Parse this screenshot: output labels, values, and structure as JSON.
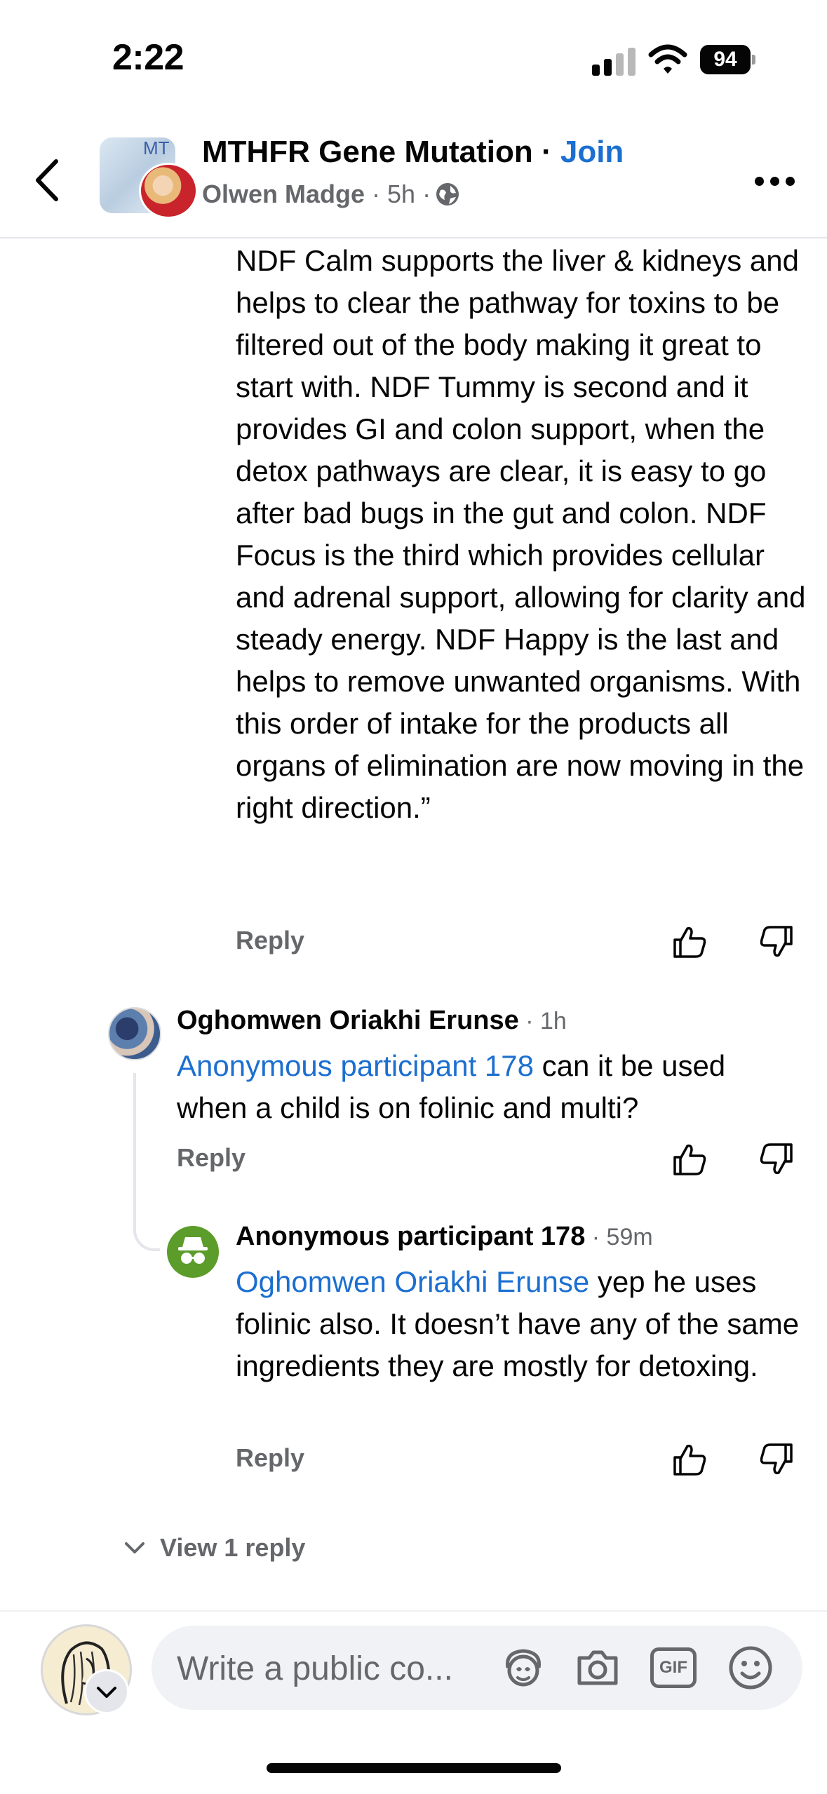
{
  "status_bar": {
    "time": "2:22",
    "battery": "94"
  },
  "header": {
    "group_name": "MTHFR Gene Mutation",
    "separator": " · ",
    "join_label": "Join",
    "author": "Olwen Madge",
    "post_age": "5h",
    "avatar_initials": "MT"
  },
  "comment_1": {
    "body": "NDF Calm supports the liver & kidneys and helps to clear the pathway for toxins to be filtered out of the body making it great to start with. NDF Tummy is second and it provides GI and colon support, when the detox pathways are clear, it is easy to go after bad bugs in the gut and colon. NDF Focus is the third which provides cellular and adrenal support, allowing for clarity and steady energy. NDF Happy is the last and helps to remove unwanted organisms. With this order of intake for the products all organs of elimination are now moving in the right direction.”",
    "reply_label": "Reply"
  },
  "comment_2": {
    "author": "Oghomwen Oriakhi Erunse",
    "time": "1h",
    "mention": "Anonymous participant 178",
    "body": " can it be used when a child is on folinic and multi?",
    "reply_label": "Reply"
  },
  "comment_3": {
    "author": "Anonymous participant 178",
    "time": "59m",
    "mention": "Oghomwen Oriakhi Erunse",
    "body": " yep he uses folinic also. It doesn’t have any of the same ingredients they are mostly for detoxing.",
    "reply_label": "Reply"
  },
  "view_replies_label": "View 1 reply",
  "composer": {
    "placeholder": "Write a public co...",
    "gif_label": "GIF"
  }
}
